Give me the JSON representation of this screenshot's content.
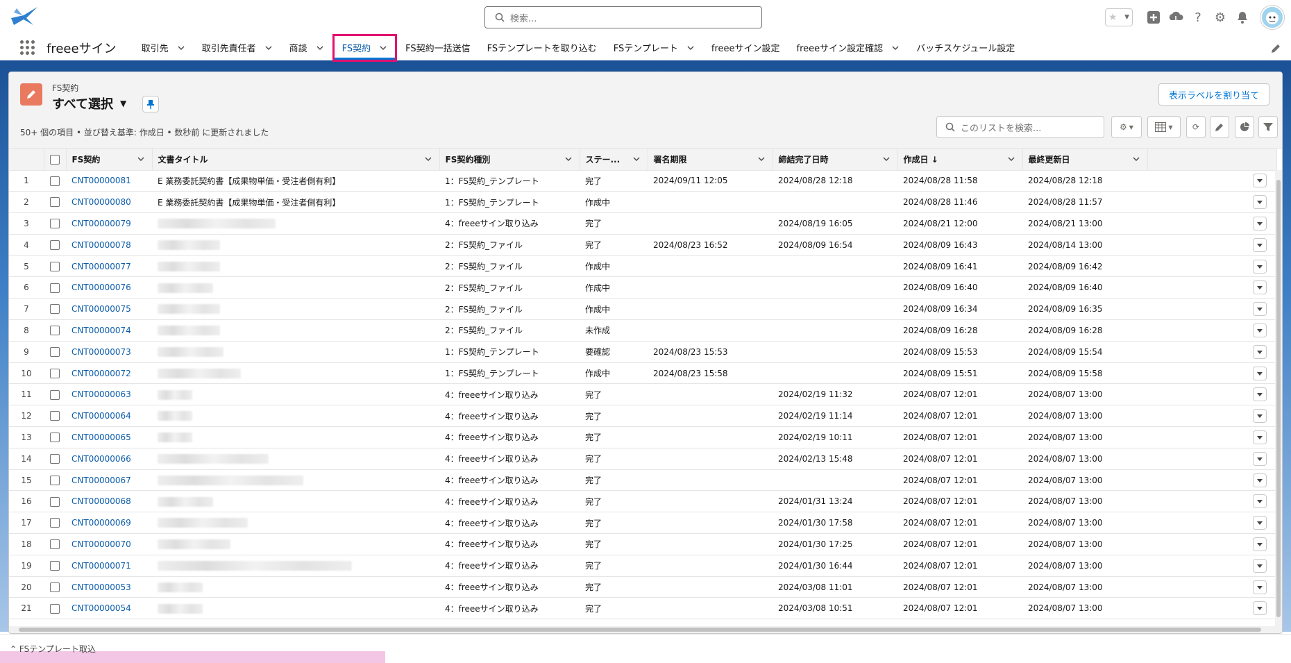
{
  "header": {
    "search_placeholder": "検索...",
    "icons": [
      "favorites-star-icon",
      "add-icon",
      "trailhead-icon",
      "help-icon",
      "setup-gear-icon",
      "notification-bell-icon",
      "user-avatar"
    ]
  },
  "nav": {
    "app_name": "freeeサイン",
    "items": [
      {
        "label": "取引先",
        "has_menu": true,
        "active": false
      },
      {
        "label": "取引先責任者",
        "has_menu": true,
        "active": false
      },
      {
        "label": "商談",
        "has_menu": true,
        "active": false
      },
      {
        "label": "FS契約",
        "has_menu": true,
        "active": true
      },
      {
        "label": "FS契約一括送信",
        "has_menu": false,
        "active": false
      },
      {
        "label": "FSテンプレートを取り込む",
        "has_menu": false,
        "active": false
      },
      {
        "label": "FSテンプレート",
        "has_menu": true,
        "active": false
      },
      {
        "label": "freeeサイン設定",
        "has_menu": false,
        "active": false
      },
      {
        "label": "freeeサイン設定確認",
        "has_menu": true,
        "active": false
      },
      {
        "label": "バッチスケジュール設定",
        "has_menu": false,
        "active": false
      }
    ]
  },
  "list": {
    "object_label": "FS契約",
    "view_name": "すべて選択",
    "assign_label_button": "表示ラベルを割り当て",
    "meta": "50+ 個の項目 • 並び替え基準: 作成日 • 数秒前 に更新されました",
    "search_placeholder": "このリストを検索...",
    "columns": [
      "FS契約",
      "文書タイトル",
      "FS契約種別",
      "ステー...",
      "署名期限",
      "締結完了日時",
      "作成日 ↓",
      "最終更新日"
    ],
    "rows": [
      {
        "n": "1",
        "id": "CNT00000081",
        "title": "E 業務委託契約書【成果物単価・受注者側有利】",
        "type": "1：FS契約_テンプレート",
        "status": "完了",
        "deadline": "2024/09/11 12:05",
        "completed": "2024/08/28 12:18",
        "created": "2024/08/28 11:58",
        "updated": "2024/08/28 12:18"
      },
      {
        "n": "2",
        "id": "CNT00000080",
        "title": "E 業務委託契約書【成果物単価・受注者側有利】",
        "type": "1：FS契約_テンプレート",
        "status": "作成中",
        "deadline": "",
        "completed": "",
        "created": "2024/08/28 11:46",
        "updated": "2024/08/28 11:57"
      },
      {
        "n": "3",
        "id": "CNT00000079",
        "title": "",
        "type": "4：freeeサイン取り込み",
        "status": "完了",
        "deadline": "",
        "completed": "2024/08/19 16:05",
        "created": "2024/08/21 12:00",
        "updated": "2024/08/21 13:00"
      },
      {
        "n": "4",
        "id": "CNT00000078",
        "title": "",
        "type": "2：FS契約_ファイル",
        "status": "完了",
        "deadline": "2024/08/23 16:52",
        "completed": "2024/08/09 16:54",
        "created": "2024/08/09 16:43",
        "updated": "2024/08/14 13:00"
      },
      {
        "n": "5",
        "id": "CNT00000077",
        "title": "",
        "type": "2：FS契約_ファイル",
        "status": "作成中",
        "deadline": "",
        "completed": "",
        "created": "2024/08/09 16:41",
        "updated": "2024/08/09 16:42"
      },
      {
        "n": "6",
        "id": "CNT00000076",
        "title": "",
        "type": "2：FS契約_ファイル",
        "status": "作成中",
        "deadline": "",
        "completed": "",
        "created": "2024/08/09 16:40",
        "updated": "2024/08/09 16:40"
      },
      {
        "n": "7",
        "id": "CNT00000075",
        "title": "",
        "type": "2：FS契約_ファイル",
        "status": "作成中",
        "deadline": "",
        "completed": "",
        "created": "2024/08/09 16:34",
        "updated": "2024/08/09 16:35"
      },
      {
        "n": "8",
        "id": "CNT00000074",
        "title": "",
        "type": "2：FS契約_ファイル",
        "status": "未作成",
        "deadline": "",
        "completed": "",
        "created": "2024/08/09 16:28",
        "updated": "2024/08/09 16:28"
      },
      {
        "n": "9",
        "id": "CNT00000073",
        "title": "",
        "type": "1：FS契約_テンプレート",
        "status": "要確認",
        "deadline": "2024/08/23 15:53",
        "completed": "",
        "created": "2024/08/09 15:53",
        "updated": "2024/08/09 15:54"
      },
      {
        "n": "10",
        "id": "CNT00000072",
        "title": "",
        "type": "1：FS契約_テンプレート",
        "status": "作成中",
        "deadline": "2024/08/23 15:58",
        "completed": "",
        "created": "2024/08/09 15:51",
        "updated": "2024/08/09 15:58"
      },
      {
        "n": "11",
        "id": "CNT00000063",
        "title": "",
        "type": "4：freeeサイン取り込み",
        "status": "完了",
        "deadline": "",
        "completed": "2024/02/19 11:32",
        "created": "2024/08/07 12:01",
        "updated": "2024/08/07 13:00"
      },
      {
        "n": "12",
        "id": "CNT00000064",
        "title": "",
        "type": "4：freeeサイン取り込み",
        "status": "完了",
        "deadline": "",
        "completed": "2024/02/19 11:14",
        "created": "2024/08/07 12:01",
        "updated": "2024/08/07 13:00"
      },
      {
        "n": "13",
        "id": "CNT00000065",
        "title": "",
        "type": "4：freeeサイン取り込み",
        "status": "完了",
        "deadline": "",
        "completed": "2024/02/19 10:11",
        "created": "2024/08/07 12:01",
        "updated": "2024/08/07 13:00"
      },
      {
        "n": "14",
        "id": "CNT00000066",
        "title": "",
        "type": "4：freeeサイン取り込み",
        "status": "完了",
        "deadline": "",
        "completed": "2024/02/13 15:48",
        "created": "2024/08/07 12:01",
        "updated": "2024/08/07 13:00"
      },
      {
        "n": "15",
        "id": "CNT00000067",
        "title": "",
        "type": "4：freeeサイン取り込み",
        "status": "完了",
        "deadline": "",
        "completed": "",
        "created": "2024/08/07 12:01",
        "updated": "2024/08/07 13:00"
      },
      {
        "n": "16",
        "id": "CNT00000068",
        "title": "",
        "type": "4：freeeサイン取り込み",
        "status": "完了",
        "deadline": "",
        "completed": "2024/01/31 13:24",
        "created": "2024/08/07 12:01",
        "updated": "2024/08/07 13:00"
      },
      {
        "n": "17",
        "id": "CNT00000069",
        "title": "",
        "type": "4：freeeサイン取り込み",
        "status": "完了",
        "deadline": "",
        "completed": "2024/01/30 17:58",
        "created": "2024/08/07 12:01",
        "updated": "2024/08/07 13:00"
      },
      {
        "n": "18",
        "id": "CNT00000070",
        "title": "",
        "type": "4：freeeサイン取り込み",
        "status": "完了",
        "deadline": "",
        "completed": "2024/01/30 17:25",
        "created": "2024/08/07 12:01",
        "updated": "2024/08/07 13:00"
      },
      {
        "n": "19",
        "id": "CNT00000071",
        "title": "",
        "type": "4：freeeサイン取り込み",
        "status": "完了",
        "deadline": "",
        "completed": "2024/01/30 16:44",
        "created": "2024/08/07 12:01",
        "updated": "2024/08/07 13:00"
      },
      {
        "n": "20",
        "id": "CNT00000053",
        "title": "",
        "type": "4：freeeサイン取り込み",
        "status": "完了",
        "deadline": "",
        "completed": "2024/03/08 11:01",
        "created": "2024/08/07 12:01",
        "updated": "2024/08/07 13:00"
      },
      {
        "n": "21",
        "id": "CNT00000054",
        "title": "",
        "type": "4：freeeサイン取り込み",
        "status": "完了",
        "deadline": "",
        "completed": "2024/03/08 10:51",
        "created": "2024/08/07 12:01",
        "updated": "2024/08/07 13:00"
      }
    ]
  },
  "utility": {
    "item_label": "FSテンプレート取込"
  },
  "colors": {
    "brand_blue": "#1b5297",
    "link": "#0b5cab",
    "highlight": "#e3106e",
    "object_icon": "#ea7a5f"
  }
}
